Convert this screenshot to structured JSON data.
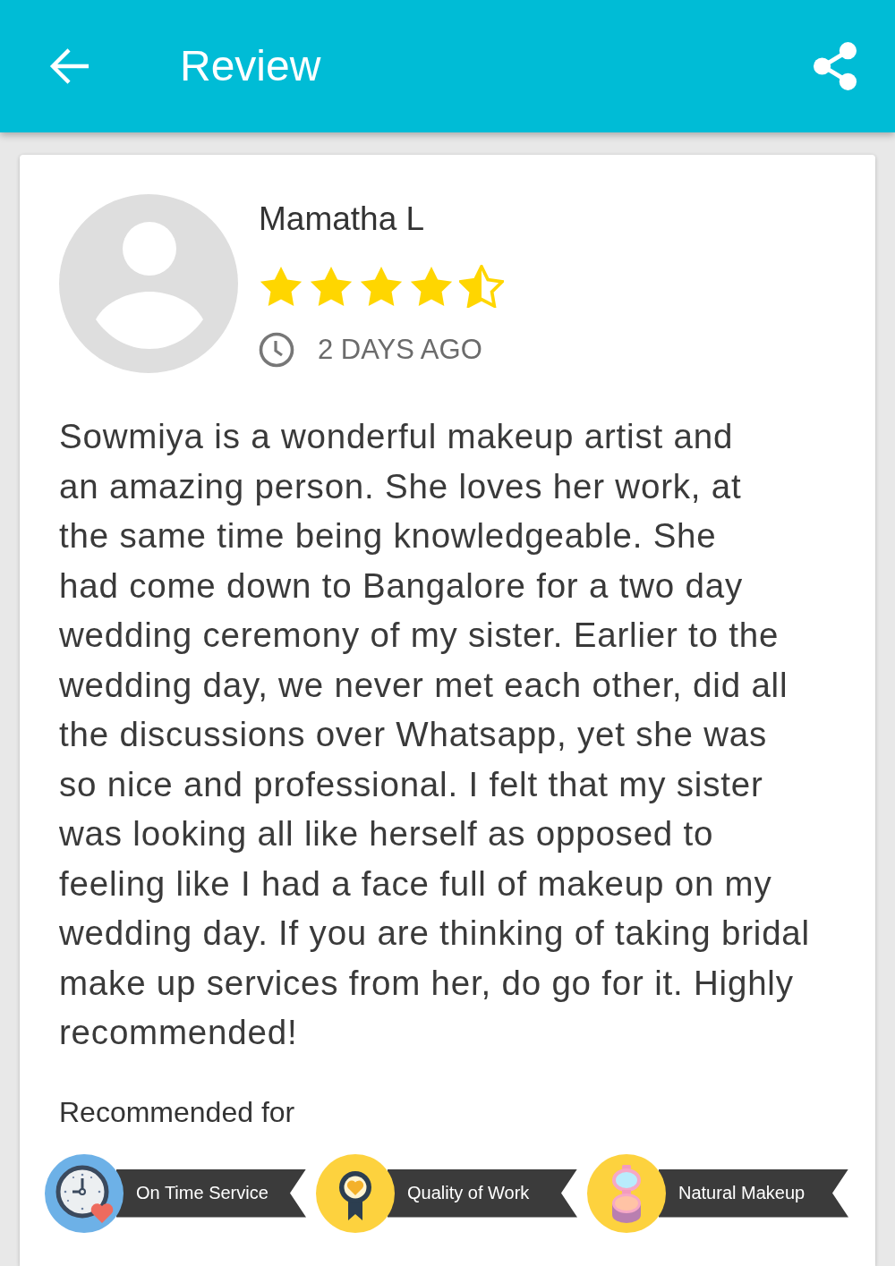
{
  "app_bar": {
    "title": "Review"
  },
  "review": {
    "author": "Mamatha L",
    "stars": 4.5,
    "time": "2 DAYS AGO",
    "text": "Sowmiya is a wonderful makeup artist and\nan amazing person. She loves her work, at\nthe same time being knowledgeable. She\nhad come down to Bangalore for a two day\nwedding ceremony of my sister. Earlier to the\nwedding day, we never met each other, did all\nthe discussions over Whatsapp, yet she was\nso nice and professional. I felt that my sister\nwas looking all like herself as opposed to\nfeeling like I had a face full of makeup on my\nwedding day. If you are thinking of taking bridal\nmake up services from her, do go for it. Highly\nrecommended!"
  },
  "recommended": {
    "heading": "Recommended for",
    "badges": [
      {
        "kind": "clock",
        "label": "On Time Service"
      },
      {
        "kind": "medal",
        "label": "Quality of Work"
      },
      {
        "kind": "compact",
        "label": "Natural Makeup"
      }
    ]
  }
}
